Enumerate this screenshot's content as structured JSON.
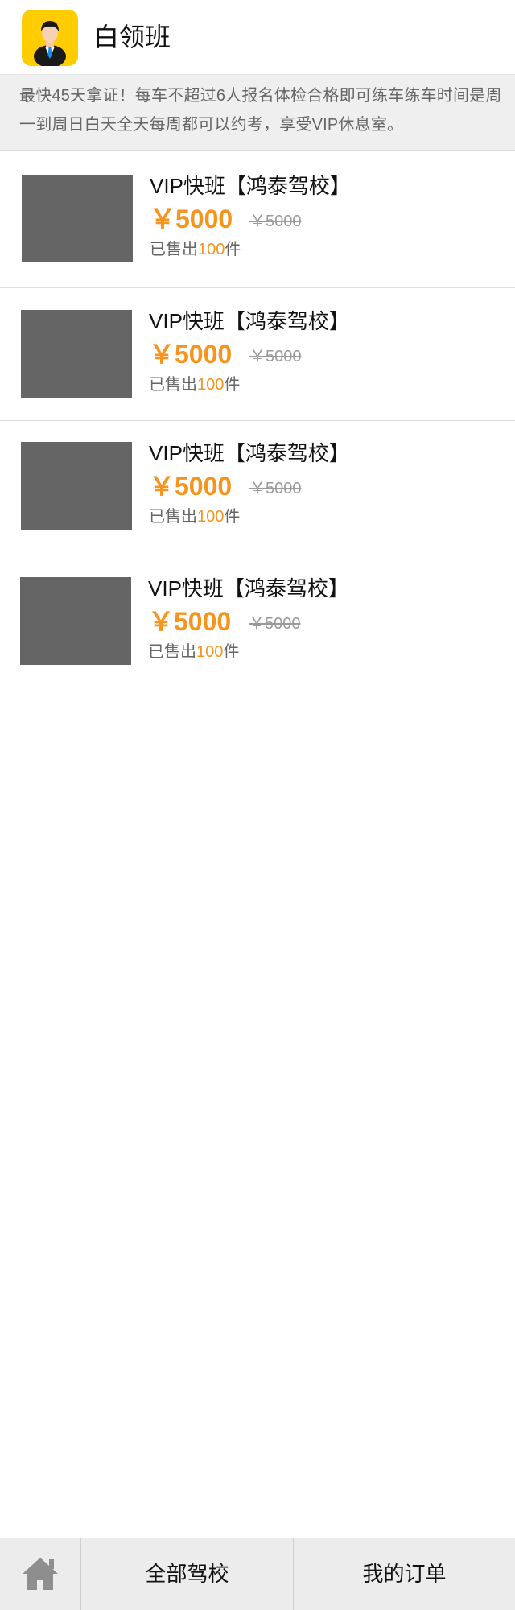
{
  "header": {
    "title": "白领班",
    "avatar_icon": "businessman-avatar-icon",
    "avatar_bg": "#ffcc00"
  },
  "notice": {
    "text": "最快45天拿证！每车不超过6人报名体检合格即可练车练车时间是周一到周日白天全天每周都可以约考，享受VIP休息室。"
  },
  "products": [
    {
      "name": "VIP快班【鸿泰驾校】",
      "price": "￥5000",
      "original_price": "￥5000",
      "sold_prefix": "已售出",
      "sold_count": "100",
      "sold_suffix": "件"
    },
    {
      "name": "VIP快班【鸿泰驾校】",
      "price": "￥5000",
      "original_price": "￥5000",
      "sold_prefix": "已售出",
      "sold_count": "100",
      "sold_suffix": "件"
    },
    {
      "name": "VIP快班【鸿泰驾校】",
      "price": "￥5000",
      "original_price": "￥5000",
      "sold_prefix": "已售出",
      "sold_count": "100",
      "sold_suffix": "件"
    },
    {
      "name": "VIP快班【鸿泰驾校】",
      "price": "￥5000",
      "original_price": "￥5000",
      "sold_prefix": "已售出",
      "sold_count": "100",
      "sold_suffix": "件"
    }
  ],
  "colors": {
    "accent": "#f7941d",
    "image_placeholder": "#656565"
  },
  "bottom_nav": {
    "home_icon": "home-icon",
    "all_schools_label": "全部驾校",
    "my_orders_label": "我的订单"
  }
}
